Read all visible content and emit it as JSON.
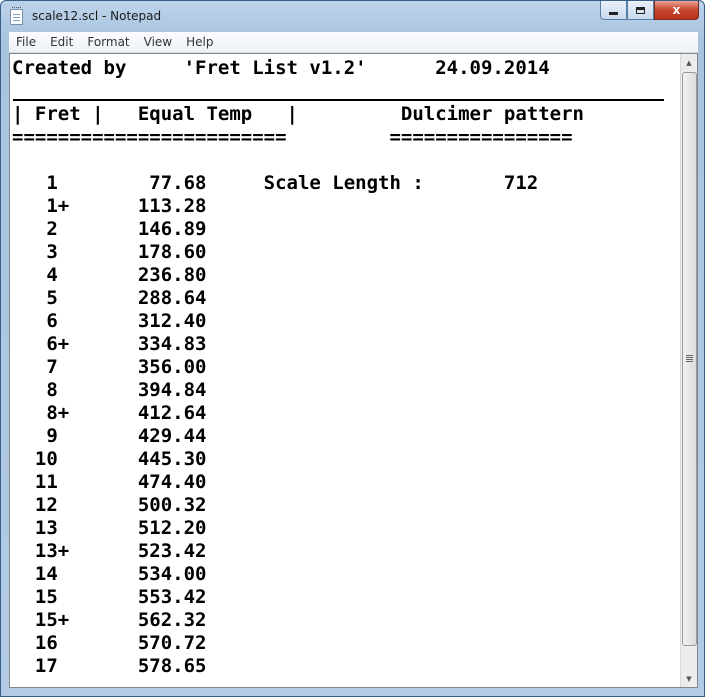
{
  "window": {
    "title": "scale12.scl - Notepad",
    "icon": "notepad-icon",
    "controls": {
      "minimize": "minimize-icon",
      "maximize": "maximize-icon",
      "close_label": "x"
    }
  },
  "menubar": {
    "items": [
      {
        "label": "File"
      },
      {
        "label": "Edit"
      },
      {
        "label": "Format"
      },
      {
        "label": "View"
      },
      {
        "label": "Help"
      }
    ]
  },
  "document": {
    "lines": [
      "Created by     'Fret List v1.2'      24.09.2014",
      "",
      "| Fret |   Equal Temp   |         Dulcimer pattern",
      "========================         ================",
      "",
      "   1        77.68     Scale Length :       712",
      "   1+      113.28",
      "   2       146.89",
      "   3       178.60",
      "   4       236.80",
      "   5       288.64",
      "   6       312.40",
      "   6+      334.83",
      "   7       356.00",
      "   8       394.84",
      "   8+      412.64",
      "   9       429.44",
      "  10       445.30",
      "  11       474.40",
      "  12       500.32",
      "  13       512.20",
      "  13+      523.42",
      "  14       534.00",
      "  15       553.42",
      "  15+      562.32",
      "  16       570.72",
      "  17       578.65"
    ]
  },
  "colors": {
    "titlebar": "#b3cbe4",
    "close": "#c7452d",
    "text": "#000000"
  }
}
